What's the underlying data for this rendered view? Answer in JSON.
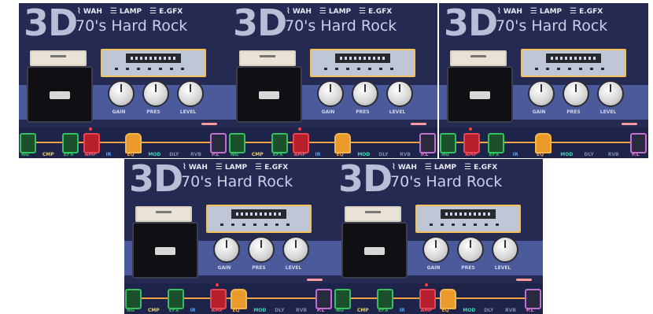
{
  "screens": [
    {
      "mode": "3D",
      "toggles": [
        {
          "icon": "wah-icon",
          "label": "WAH"
        },
        {
          "icon": "lamp-icon",
          "label": "LAMP"
        },
        {
          "icon": "lamp-icon",
          "label": "E.GFX"
        }
      ],
      "preset_name": "70's Hard Rock",
      "knobs": [
        "GAIN",
        "PRES",
        "LEVEL"
      ],
      "chain": [
        {
          "label": "NG",
          "state": "green-active"
        },
        {
          "label": "CMP",
          "state": "green"
        },
        {
          "label": "EFX",
          "state": "green-active"
        },
        {
          "label": "AMP",
          "state": "red-active"
        },
        {
          "label": "IR",
          "state": "blue"
        },
        {
          "label": "EQ",
          "state": "orange-active"
        },
        {
          "label": "MOD",
          "state": "teal"
        },
        {
          "label": "DLY",
          "state": "gray"
        },
        {
          "label": "RVB",
          "state": "gray"
        },
        {
          "label": "P.L",
          "state": "pink-active"
        }
      ],
      "marker_index": 3
    },
    {
      "mode": "3D",
      "toggles": [
        {
          "icon": "wah-icon",
          "label": "WAH"
        },
        {
          "icon": "lamp-icon",
          "label": "LAMP"
        },
        {
          "icon": "lamp-icon",
          "label": "E.GFX"
        }
      ],
      "preset_name": "70's Hard Rock",
      "knobs": [
        "GAIN",
        "PRES",
        "LEVEL"
      ],
      "chain": [
        {
          "label": "NG",
          "state": "green-active"
        },
        {
          "label": "CMP",
          "state": "green"
        },
        {
          "label": "EFX",
          "state": "green-active"
        },
        {
          "label": "AMP",
          "state": "red-active"
        },
        {
          "label": "IR",
          "state": "blue"
        },
        {
          "label": "EQ",
          "state": "orange-active"
        },
        {
          "label": "MOD",
          "state": "teal"
        },
        {
          "label": "DLY",
          "state": "gray"
        },
        {
          "label": "RVB",
          "state": "gray"
        },
        {
          "label": "P.L",
          "state": "pink-active"
        }
      ],
      "marker_index": 3
    },
    {
      "mode": "3D",
      "toggles": [
        {
          "icon": "wah-icon",
          "label": "WAH"
        },
        {
          "icon": "lamp-icon",
          "label": "LAMP"
        },
        {
          "icon": "lamp-icon",
          "label": "E.GFX"
        }
      ],
      "preset_name": "70's Hard Rock",
      "knobs": [
        "GAIN",
        "PRES",
        "LEVEL"
      ],
      "chain": [
        {
          "label": "NG",
          "state": "green-active"
        },
        {
          "label": "AMP",
          "state": "red-active"
        },
        {
          "label": "EFX",
          "state": "green-active"
        },
        {
          "label": "IR",
          "state": "blue"
        },
        {
          "label": "EQ",
          "state": "orange-active"
        },
        {
          "label": "MOD",
          "state": "teal"
        },
        {
          "label": "DLY",
          "state": "gray"
        },
        {
          "label": "RVB",
          "state": "gray"
        },
        {
          "label": "P.L",
          "state": "pink-active"
        }
      ],
      "marker_index": 1
    },
    {
      "mode": "3D",
      "toggles": [
        {
          "icon": "wah-icon",
          "label": "WAH"
        },
        {
          "icon": "lamp-icon",
          "label": "LAMP"
        },
        {
          "icon": "lamp-icon",
          "label": "E.GFX"
        }
      ],
      "preset_name": "70's Hard Rock",
      "knobs": [
        "GAIN",
        "PRES",
        "LEVEL"
      ],
      "chain": [
        {
          "label": "NG",
          "state": "green-active"
        },
        {
          "label": "CMP",
          "state": "green"
        },
        {
          "label": "EFX",
          "state": "green-active"
        },
        {
          "label": "IR",
          "state": "blue"
        },
        {
          "label": "AMP",
          "state": "red-active"
        },
        {
          "label": "EQ",
          "state": "orange-active"
        },
        {
          "label": "MOD",
          "state": "teal"
        },
        {
          "label": "DLY",
          "state": "gray"
        },
        {
          "label": "RVB",
          "state": "gray"
        },
        {
          "label": "P.L",
          "state": "pink-active"
        }
      ],
      "marker_index": 4
    },
    {
      "mode": "3D",
      "toggles": [
        {
          "icon": "wah-icon",
          "label": "WAH"
        },
        {
          "icon": "lamp-icon",
          "label": "LAMP"
        },
        {
          "icon": "lamp-icon",
          "label": "E.GFX"
        }
      ],
      "preset_name": "70's Hard Rock",
      "knobs": [
        "GAIN",
        "PRES",
        "LEVEL"
      ],
      "chain": [
        {
          "label": "NG",
          "state": "green-active"
        },
        {
          "label": "CMP",
          "state": "green"
        },
        {
          "label": "EFX",
          "state": "green-active"
        },
        {
          "label": "IR",
          "state": "blue"
        },
        {
          "label": "AMP",
          "state": "red-active"
        },
        {
          "label": "EQ",
          "state": "orange-active"
        },
        {
          "label": "MOD",
          "state": "teal"
        },
        {
          "label": "DLY",
          "state": "gray"
        },
        {
          "label": "RVB",
          "state": "gray"
        },
        {
          "label": "P.L",
          "state": "pink-active"
        }
      ],
      "marker_index": 4
    }
  ],
  "colors": {
    "background": "#252a52",
    "band": "#4a5a9a",
    "accent_orange": "#f2a245",
    "amp_red": "#b5202c",
    "fx_green": "#34c15b",
    "pl_pink": "#c070d0"
  }
}
